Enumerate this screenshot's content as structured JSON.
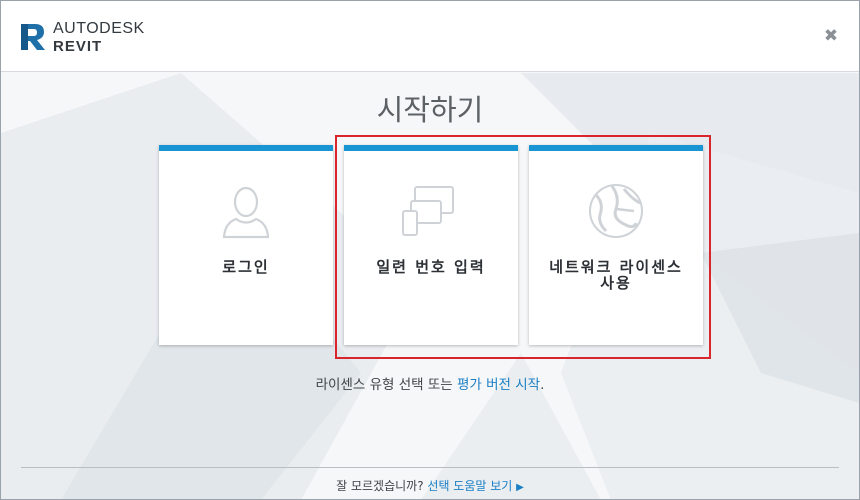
{
  "brand": {
    "name_line1": "AUTODESK",
    "name_line2": "REVIT",
    "accent": "#1a95d3"
  },
  "window": {
    "close_icon": "close-icon"
  },
  "main": {
    "title": "시작하기",
    "cards": [
      {
        "label": "로그인",
        "icon": "user-icon"
      },
      {
        "label": "일련 번호 입력",
        "icon": "devices-icon"
      },
      {
        "label_line1": "네트워크 라이센스",
        "label_line2": "사용",
        "icon": "network-globe-icon"
      }
    ],
    "license_text": "라이센스 유형 선택 또는 ",
    "trial_link": "평가 버전 시작",
    "license_suffix": "."
  },
  "footer": {
    "question": "잘 모르겠습니까? ",
    "help_link": "선택 도움말 보기",
    "arrow_icon": "play-arrow-icon"
  },
  "colors": {
    "highlight": "#d9262c",
    "link": "#1a7fc4"
  }
}
